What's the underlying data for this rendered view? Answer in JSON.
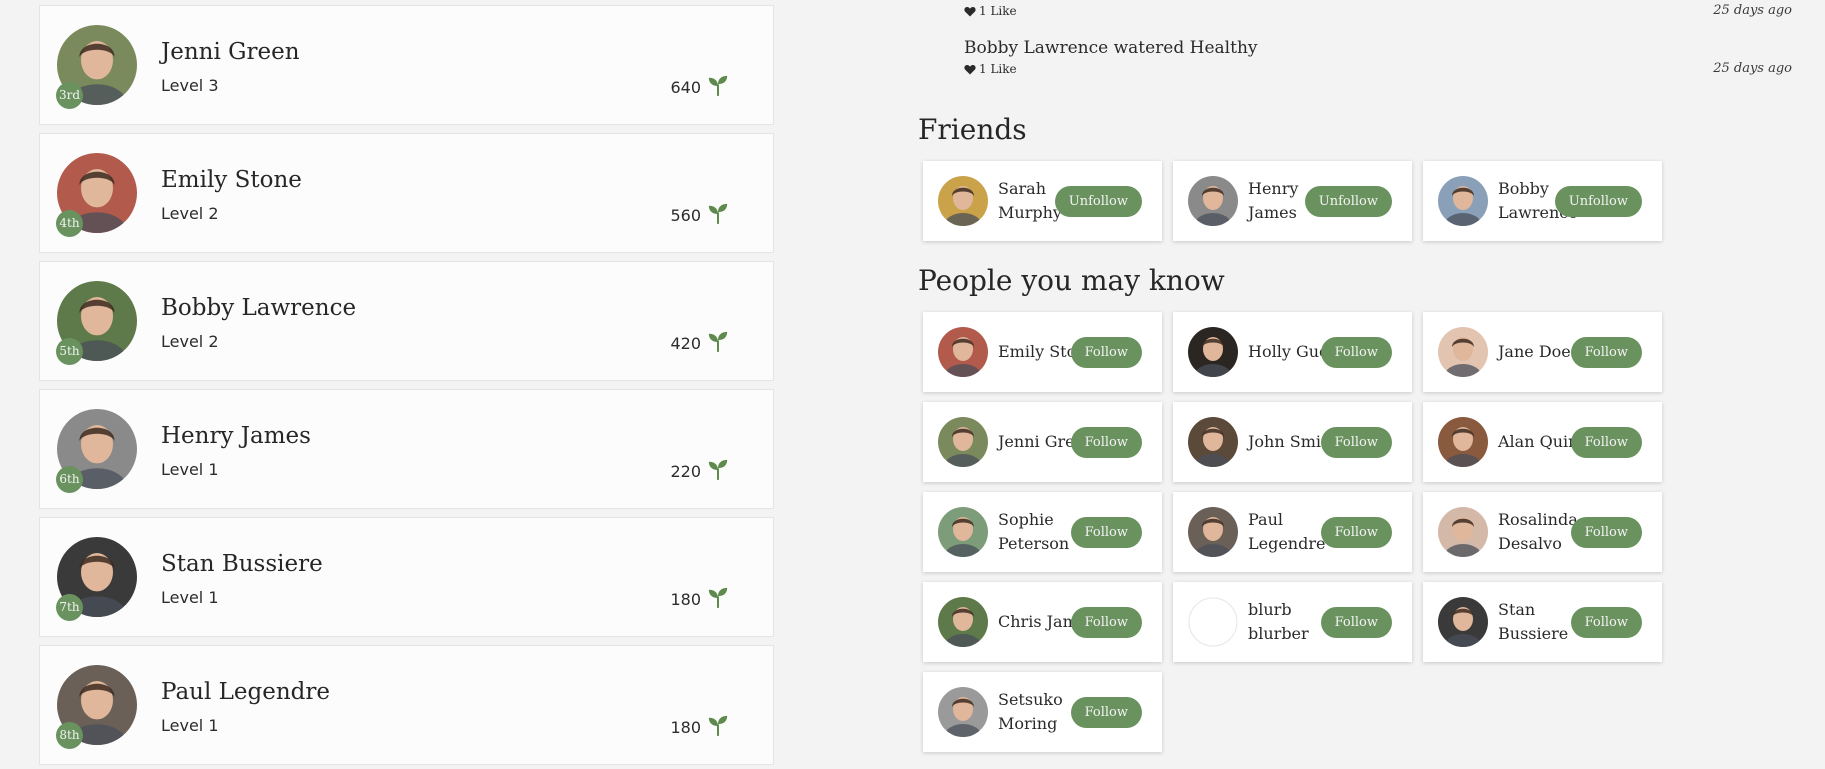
{
  "leaderboard": [
    {
      "name": "Jenni Green",
      "level": "Level 3",
      "rank": "3rd",
      "points": "640",
      "avatar_color": "#7a8a5c"
    },
    {
      "name": "Emily Stone",
      "level": "Level 2",
      "rank": "4th",
      "points": "560",
      "avatar_color": "#b25a4c"
    },
    {
      "name": "Bobby Lawrence",
      "level": "Level 2",
      "rank": "5th",
      "points": "420",
      "avatar_color": "#5e7a4a"
    },
    {
      "name": "Henry James",
      "level": "Level 1",
      "rank": "6th",
      "points": "220",
      "avatar_color": "#8a8a8a"
    },
    {
      "name": "Stan Bussiere",
      "level": "Level 1",
      "rank": "7th",
      "points": "180",
      "avatar_color": "#3a3a3a"
    },
    {
      "name": "Paul Legendre",
      "level": "Level 1",
      "rank": "8th",
      "points": "180",
      "avatar_color": "#6b6058"
    }
  ],
  "activity": [
    {
      "text": "",
      "likes": "1 Like",
      "time": "25 days ago"
    },
    {
      "text": "Bobby Lawrence watered Healthy",
      "likes": "1 Like",
      "time": "25 days ago"
    }
  ],
  "friends": {
    "title": "Friends",
    "items": [
      {
        "name": "Sarah Murphy",
        "button": "Unfollow",
        "avatar_color": "#c9a24a"
      },
      {
        "name": "Henry James",
        "button": "Unfollow",
        "avatar_color": "#8a8a8a"
      },
      {
        "name": "Bobby Lawrence",
        "button": "Unfollow",
        "avatar_color": "#8aa0b8"
      }
    ]
  },
  "suggestions": {
    "title": "People you may know",
    "items": [
      {
        "name": "Emily Stone",
        "button": "Follow",
        "avatar_color": "#b25a4c"
      },
      {
        "name": "Holly Gueye",
        "button": "Follow",
        "avatar_color": "#2c2622"
      },
      {
        "name": "Jane Doe",
        "button": "Follow",
        "avatar_color": "#e2c4b0"
      },
      {
        "name": "Jenni Green",
        "button": "Follow",
        "avatar_color": "#7a8a5c"
      },
      {
        "name": "John Smith",
        "button": "Follow",
        "avatar_color": "#5b4a3a"
      },
      {
        "name": "Alan Quinn",
        "button": "Follow",
        "avatar_color": "#8a5a3e"
      },
      {
        "name": "Sophie Peterson",
        "button": "Follow",
        "avatar_color": "#7d9c7a"
      },
      {
        "name": "Paul Legendre",
        "button": "Follow",
        "avatar_color": "#6b6058"
      },
      {
        "name": "Rosalinda Desalvo",
        "button": "Follow",
        "avatar_color": "#d4b8a8"
      },
      {
        "name": "Chris James",
        "button": "Follow",
        "avatar_color": "#5e7a4a"
      },
      {
        "name": "blurb blurber",
        "button": "Follow",
        "avatar_color": "#ffffff"
      },
      {
        "name": "Stan Bussiere",
        "button": "Follow",
        "avatar_color": "#3a3a3a"
      },
      {
        "name": "Setsuko Moring",
        "button": "Follow",
        "avatar_color": "#9a9a9a"
      }
    ]
  },
  "colors": {
    "accent": "#6a925f",
    "background": "#f3f3f3",
    "card": "#ffffff"
  },
  "icons": {
    "points": "sprout-icon",
    "likes": "heart-icon"
  }
}
